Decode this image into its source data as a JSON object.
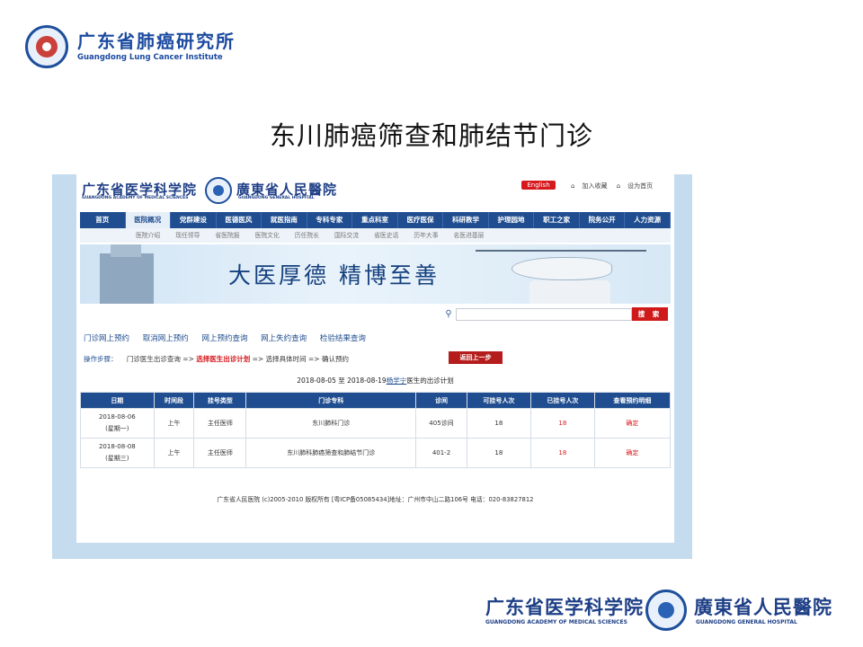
{
  "slide": {
    "institute_cn": "广东省肺癌研究所",
    "institute_en": "Guangdong Lung Cancer Institute",
    "title": "东川肺癌筛查和肺结节门诊"
  },
  "header": {
    "academy_cn": "广东省医学科学院",
    "academy_en": "GUANGDONG ACADEMY OF MEDICAL SCIENCES",
    "hospital_cn": "廣東省人民醫院",
    "hospital_en": "GUANGDONG GENERAL HOSPITAL",
    "english_label": "English",
    "favorite_label": "加入收藏",
    "homepage_label": "设为首页"
  },
  "nav": {
    "items": [
      "首页",
      "医院概况",
      "党群建设",
      "医德医风",
      "就医指南",
      "专科专家",
      "重点科室",
      "医疗医保",
      "科研教学",
      "护理园地",
      "职工之家",
      "院务公开",
      "人力资源"
    ]
  },
  "subnav": {
    "items": [
      "医院介绍",
      "现任领导",
      "省医院报",
      "医院文化",
      "历任院长",
      "国际交流",
      "省医史话",
      "历年大事",
      "名医进基层"
    ]
  },
  "banner": {
    "slogan": "大医厚德  精博至善"
  },
  "search": {
    "placeholder": "",
    "button_label": "搜 索"
  },
  "menu": {
    "links": [
      "门诊网上预约",
      "取消网上预约",
      "网上预约查询",
      "网上失约查询",
      "检验结果查询"
    ]
  },
  "steps": {
    "label": "操作步骤：",
    "step1": "门诊医生出诊查询",
    "arrow": "=>",
    "step2": "选择医生出诊计划",
    "step3": "选择具体时间",
    "step4": "确认预约",
    "back_label": "返回上一步"
  },
  "schedule": {
    "range": "2018-08-05 至 2018-08-19",
    "doctor": "杨学宁",
    "suffix": "医生的出诊计划",
    "headers": [
      "日期",
      "时间段",
      "挂号类型",
      "门诊专科",
      "诊间",
      "可挂号人次",
      "已挂号人次",
      "查看预约明细"
    ],
    "rows": [
      {
        "date": "2018-08-06",
        "weekday": "(星期一)",
        "period": "上午",
        "type": "主任医师",
        "clinic": "东川肺科门诊",
        "room": "405诊间",
        "available": "18",
        "booked": "18",
        "action": "确定"
      },
      {
        "date": "2018-08-08",
        "weekday": "(星期三)",
        "period": "上午",
        "type": "主任医师",
        "clinic": "东川肺科肺癌筛查和肺结节门诊",
        "room": "401-2",
        "available": "18",
        "booked": "18",
        "action": "确定"
      }
    ]
  },
  "footer": {
    "text": "广东省人民医院 (c)2005-2010 版权所有 [粤ICP备05085434]地址：广州市中山二路106号 电话：020-83827812"
  },
  "bottom_logo": {
    "academy_cn": "广东省医学科学院",
    "academy_en": "GUANGDONG ACADEMY OF MEDICAL SCIENCES",
    "hospital_cn": "廣東省人民醫院",
    "hospital_en": "GUANGDONG GENERAL HOSPITAL"
  },
  "colors": {
    "nav_blue": "#1f4d8f",
    "accent_red": "#d7191e",
    "frame_bg": "#c5dcee"
  }
}
